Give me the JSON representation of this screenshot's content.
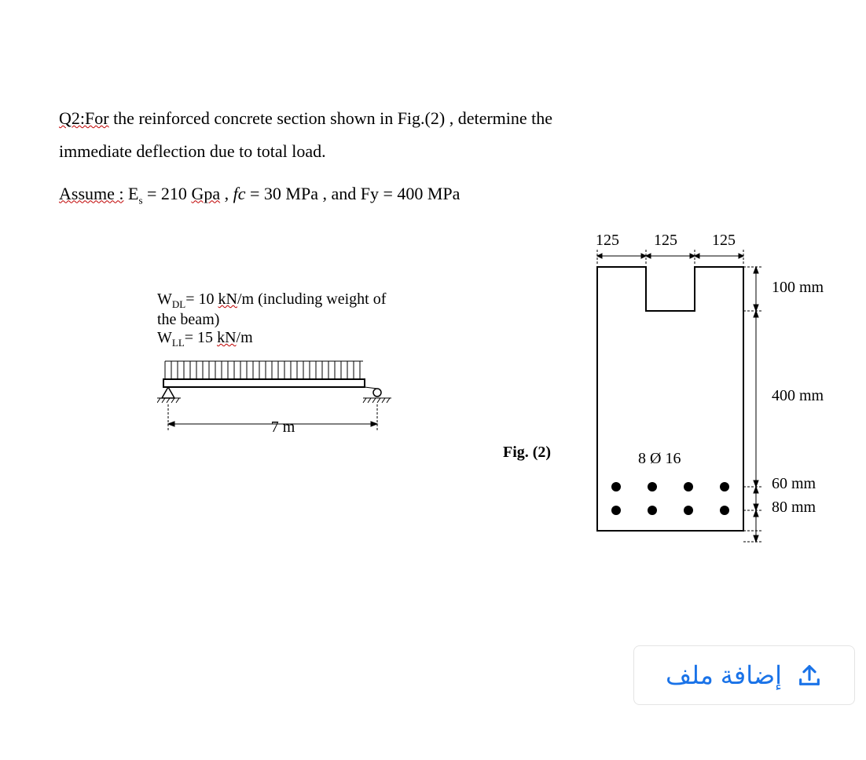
{
  "question": {
    "prefix": "Q2:For",
    "rest_line1": " the reinforced concrete section shown in Fig.(2) , determine the",
    "line2": "immediate deflection due to total load.",
    "assume_word": "Assume :",
    "es_label": " E",
    "es_sub": "s",
    "es_eq": " = 210 ",
    "gpa": "Gpa",
    "fc_label": " , ",
    "fc_sym": "fc",
    "fc_val": " = 30 MPa",
    "fy": " ,  and Fy = 400 MPa"
  },
  "beam": {
    "wdl_label": "W",
    "wdl_sub": "DL",
    "wdl_eq": "= 10 ",
    "wdl_kn": "kN",
    "wdl_rest": "/m (including weight of the beam)",
    "wll_label": "W",
    "wll_sub": "LL",
    "wll_eq": "= 15 ",
    "wll_kn": "kN",
    "wll_rest": "/m",
    "span": "7 m"
  },
  "section": {
    "d125_1": "125",
    "d125_2": "125",
    "d125_3": "125",
    "d100": "100 mm",
    "d400": "400 mm",
    "d60": "60 mm",
    "d80": "80 mm",
    "bars": "8 Ø 16"
  },
  "fig_label": "Fig. (2)",
  "upload": {
    "label": "إضافة ملف"
  }
}
